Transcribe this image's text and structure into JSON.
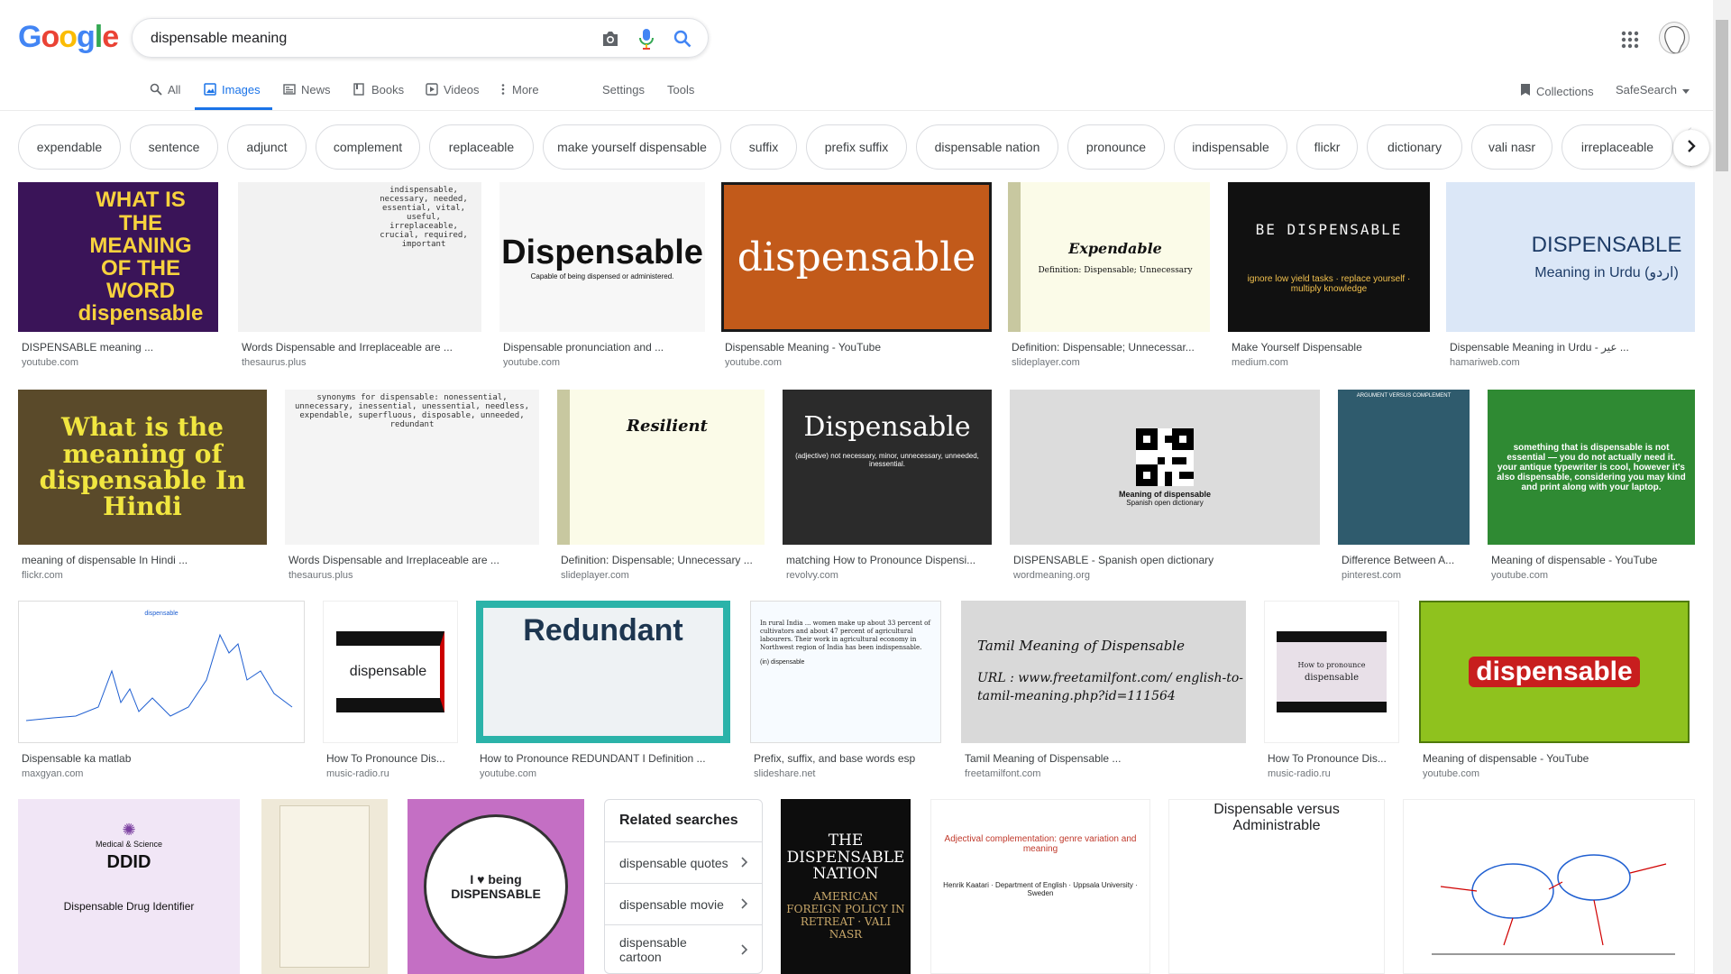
{
  "logo": {
    "letters": [
      "G",
      "o",
      "o",
      "g",
      "l",
      "e"
    ],
    "colors": [
      "#4285f4",
      "#ea4335",
      "#fbbc05",
      "#4285f4",
      "#34a853",
      "#ea4335"
    ]
  },
  "search": {
    "query": "dispensable meaning"
  },
  "icons": {
    "camera": "camera-icon",
    "mic": "microphone-icon",
    "search": "search-icon",
    "apps": "apps-grid-icon",
    "collections": "bookmark-icon"
  },
  "tabs": [
    {
      "label": "All",
      "icon": "search-icon"
    },
    {
      "label": "Images",
      "icon": "image-icon",
      "active": true
    },
    {
      "label": "News",
      "icon": "news-icon"
    },
    {
      "label": "Books",
      "icon": "book-icon"
    },
    {
      "label": "Videos",
      "icon": "video-icon"
    },
    {
      "label": "More",
      "icon": "more-vert-icon"
    },
    {
      "label": "Settings"
    },
    {
      "label": "Tools"
    }
  ],
  "collections_label": "Collections",
  "safesearch_label": "SafeSearch",
  "chips": [
    "expendable",
    "sentence",
    "adjunct",
    "complement",
    "replaceable",
    "make yourself dispensable",
    "suffix",
    "prefix suffix",
    "dispensable nation",
    "pronounce",
    "indispensable",
    "flickr",
    "dictionary",
    "vali nasr",
    "irreplaceable"
  ],
  "accent_color": "#1a73e8",
  "results": [
    {
      "title": "DISPENSABLE meaning ...",
      "source": "youtube.com",
      "thumb_text": "WHAT IS THE MEANING OF THE WORD dispensable",
      "bg": "#3a1458",
      "fg": "#f7d23d"
    },
    {
      "title": "Words Dispensable and Irreplaceable are ...",
      "source": "thesaurus.plus",
      "thumb_text": "indispensable, necessary, needed, essential, vital, useful, irreplaceable, crucial, required, important",
      "bg": "#f2f2f2",
      "fg": "#333333"
    },
    {
      "title": "Dispensable pronunciation and ...",
      "source": "youtube.com",
      "thumb_text": "Dispensable",
      "sub_text": "Capable of being dispensed or administered.",
      "bg": "#f7f7f7",
      "fg": "#111111"
    },
    {
      "title": "Dispensable Meaning - YouTube",
      "source": "youtube.com",
      "thumb_text": "dispensable",
      "bg": "#c25a1a",
      "fg": "#ffffff"
    },
    {
      "title": "Definition: Dispensable; Unnecessar...",
      "source": "slideplayer.com",
      "thumb_text": "Expendable",
      "sub_text": "Definition: Dispensable; Unnecessary",
      "bg": "#fbfbe8",
      "fg": "#111111"
    },
    {
      "title": "Make Yourself Dispensable",
      "source": "medium.com",
      "thumb_text": "BE DISPENSABLE",
      "sub_text": "ignore low yield tasks · replace yourself · multiply knowledge",
      "bg": "#111111",
      "fg": "#f4f4f4"
    },
    {
      "title": "Dispensable Meaning in Urdu - عیر ...",
      "source": "hamariweb.com",
      "thumb_text": "DISPENSABLE",
      "sub_text": "Meaning in Urdu (اردو)",
      "bg": "#dbe7f7",
      "fg": "#1d3b66"
    },
    {
      "title": "meaning of dispensable In Hindi ...",
      "source": "flickr.com",
      "thumb_text": "What is the meaning of dispensable In Hindi",
      "bg": "#5a4a2a",
      "fg": "#f1e640"
    },
    {
      "title": "Words Dispensable and Irreplaceable are ...",
      "source": "thesaurus.plus",
      "thumb_text": "synonyms for dispensable: nonessential, unnecessary, inessential, unessential, needless, expendable, superfluous, disposable, unneeded, redundant",
      "bg": "#f4f4f4",
      "fg": "#333333"
    },
    {
      "title": "Definition: Dispensable; Unnecessary ...",
      "source": "slideplayer.com",
      "thumb_text": "Resilient",
      "bg": "#fbfbe8",
      "fg": "#111111"
    },
    {
      "title": "matching How to Pronounce Dispensi...",
      "source": "revolvy.com",
      "thumb_text": "Dispensable",
      "sub_text": "(adjective) not necessary, minor, unnecessary, unneeded, inessential.",
      "bg": "#2b2b2b",
      "fg": "#ffffff"
    },
    {
      "title": "DISPENSABLE - Spanish open dictionary",
      "source": "wordmeaning.org",
      "thumb_text": "Meaning of dispensable",
      "sub_text": "Spanish open dictionary",
      "bg": "#dcdcdc",
      "fg": "#111111"
    },
    {
      "title": "Difference Between A...",
      "source": "pinterest.com",
      "thumb_text": "ARGUMENT VERSUS COMPLEMENT",
      "bg": "#2f5b6d",
      "fg": "#ffffff"
    },
    {
      "title": "Meaning of dispensable - YouTube",
      "source": "youtube.com",
      "thumb_text": "something that is dispensable is not essential — you do not actually need it. your antique typewriter is cool, however it's also dispensable, considering you may kind and print along with your laptop.",
      "bg": "#2f8a33",
      "fg": "#ffffff"
    },
    {
      "title": "Dispensable ka matlab",
      "source": "maxgyan.com",
      "thumb_text": "dispensable",
      "bg": "#ffffff",
      "fg": "#1f5fd1"
    },
    {
      "title": "How To Pronounce Dis...",
      "source": "music-radio.ru",
      "thumb_text": "dispensable",
      "bg": "#ffffff",
      "fg": "#111111"
    },
    {
      "title": "How to Pronounce REDUNDANT I Definition ...",
      "source": "youtube.com",
      "thumb_text": "Redundant",
      "bg": "#2bb3a9",
      "fg": "#1d3650"
    },
    {
      "title": "Prefix, suffix, and base words esp",
      "source": "slideshare.net",
      "thumb_text": "In rural India ... women make up about 33 percent of cultivators and about 47 percent of agricultural labourers. Their work in agricultural economy in Northwest region of India has been indispensable.",
      "sub_text": "(in) dispensable",
      "bg": "#f7fbff",
      "fg": "#222222"
    },
    {
      "title": "Tamil Meaning of Dispensable ...",
      "source": "freetamilfont.com",
      "thumb_text": "Tamil Meaning of Dispensable",
      "sub_text": "URL : www.freetamilfont.com/ english-to-tamil-meaning.php?id=111564",
      "bg": "#d9d9d9",
      "fg": "#111111"
    },
    {
      "title": "How To Pronounce Dis...",
      "source": "music-radio.ru",
      "thumb_text": "dispensable",
      "sub_text": "How to pronounce",
      "bg": "#ffffff",
      "fg": "#111111"
    },
    {
      "title": "Meaning of dispensable - YouTube",
      "source": "youtube.com",
      "thumb_text": "dispensable",
      "bg": "#8fc21e",
      "fg": "#ffffff"
    },
    {
      "title": "",
      "source": "",
      "thumb_text": "DDID",
      "sub_text": "Dispensable Drug Identifier",
      "pre_text": "Medical & Science",
      "bg": "#f1e6f6",
      "fg": "#111111"
    },
    {
      "title": "",
      "source": "",
      "thumb_text": "",
      "bg": "#efe9d8",
      "fg": "#333333"
    },
    {
      "title": "",
      "source": "",
      "thumb_text": "I ♥ being DISPENSABLE",
      "bg": "#c46fc4",
      "fg": "#111111"
    },
    {
      "title": "",
      "source": "",
      "thumb_text": "THE DISPENSABLE NATION",
      "sub_text": "AMERICAN FOREIGN POLICY IN RETREAT · VALI NASR",
      "bg": "#0d0d0d",
      "fg": "#ffffff"
    },
    {
      "title": "",
      "source": "",
      "thumb_text": "Adjectival complementation: genre variation and meaning",
      "sub_text": "Henrik Kaatari · Department of English · Uppsala University · Sweden",
      "bg": "#ffffff",
      "fg": "#c0392b"
    },
    {
      "title": "",
      "source": "",
      "thumb_text": "Dispensable versus Administrable",
      "bg": "#ffffff",
      "fg": "#111111"
    },
    {
      "title": "",
      "source": "",
      "thumb_text": "",
      "bg": "#ffffff",
      "fg": "#d00000"
    }
  ],
  "related": {
    "heading": "Related searches",
    "items": [
      "dispensable quotes",
      "dispensable movie",
      "dispensable cartoon"
    ]
  }
}
